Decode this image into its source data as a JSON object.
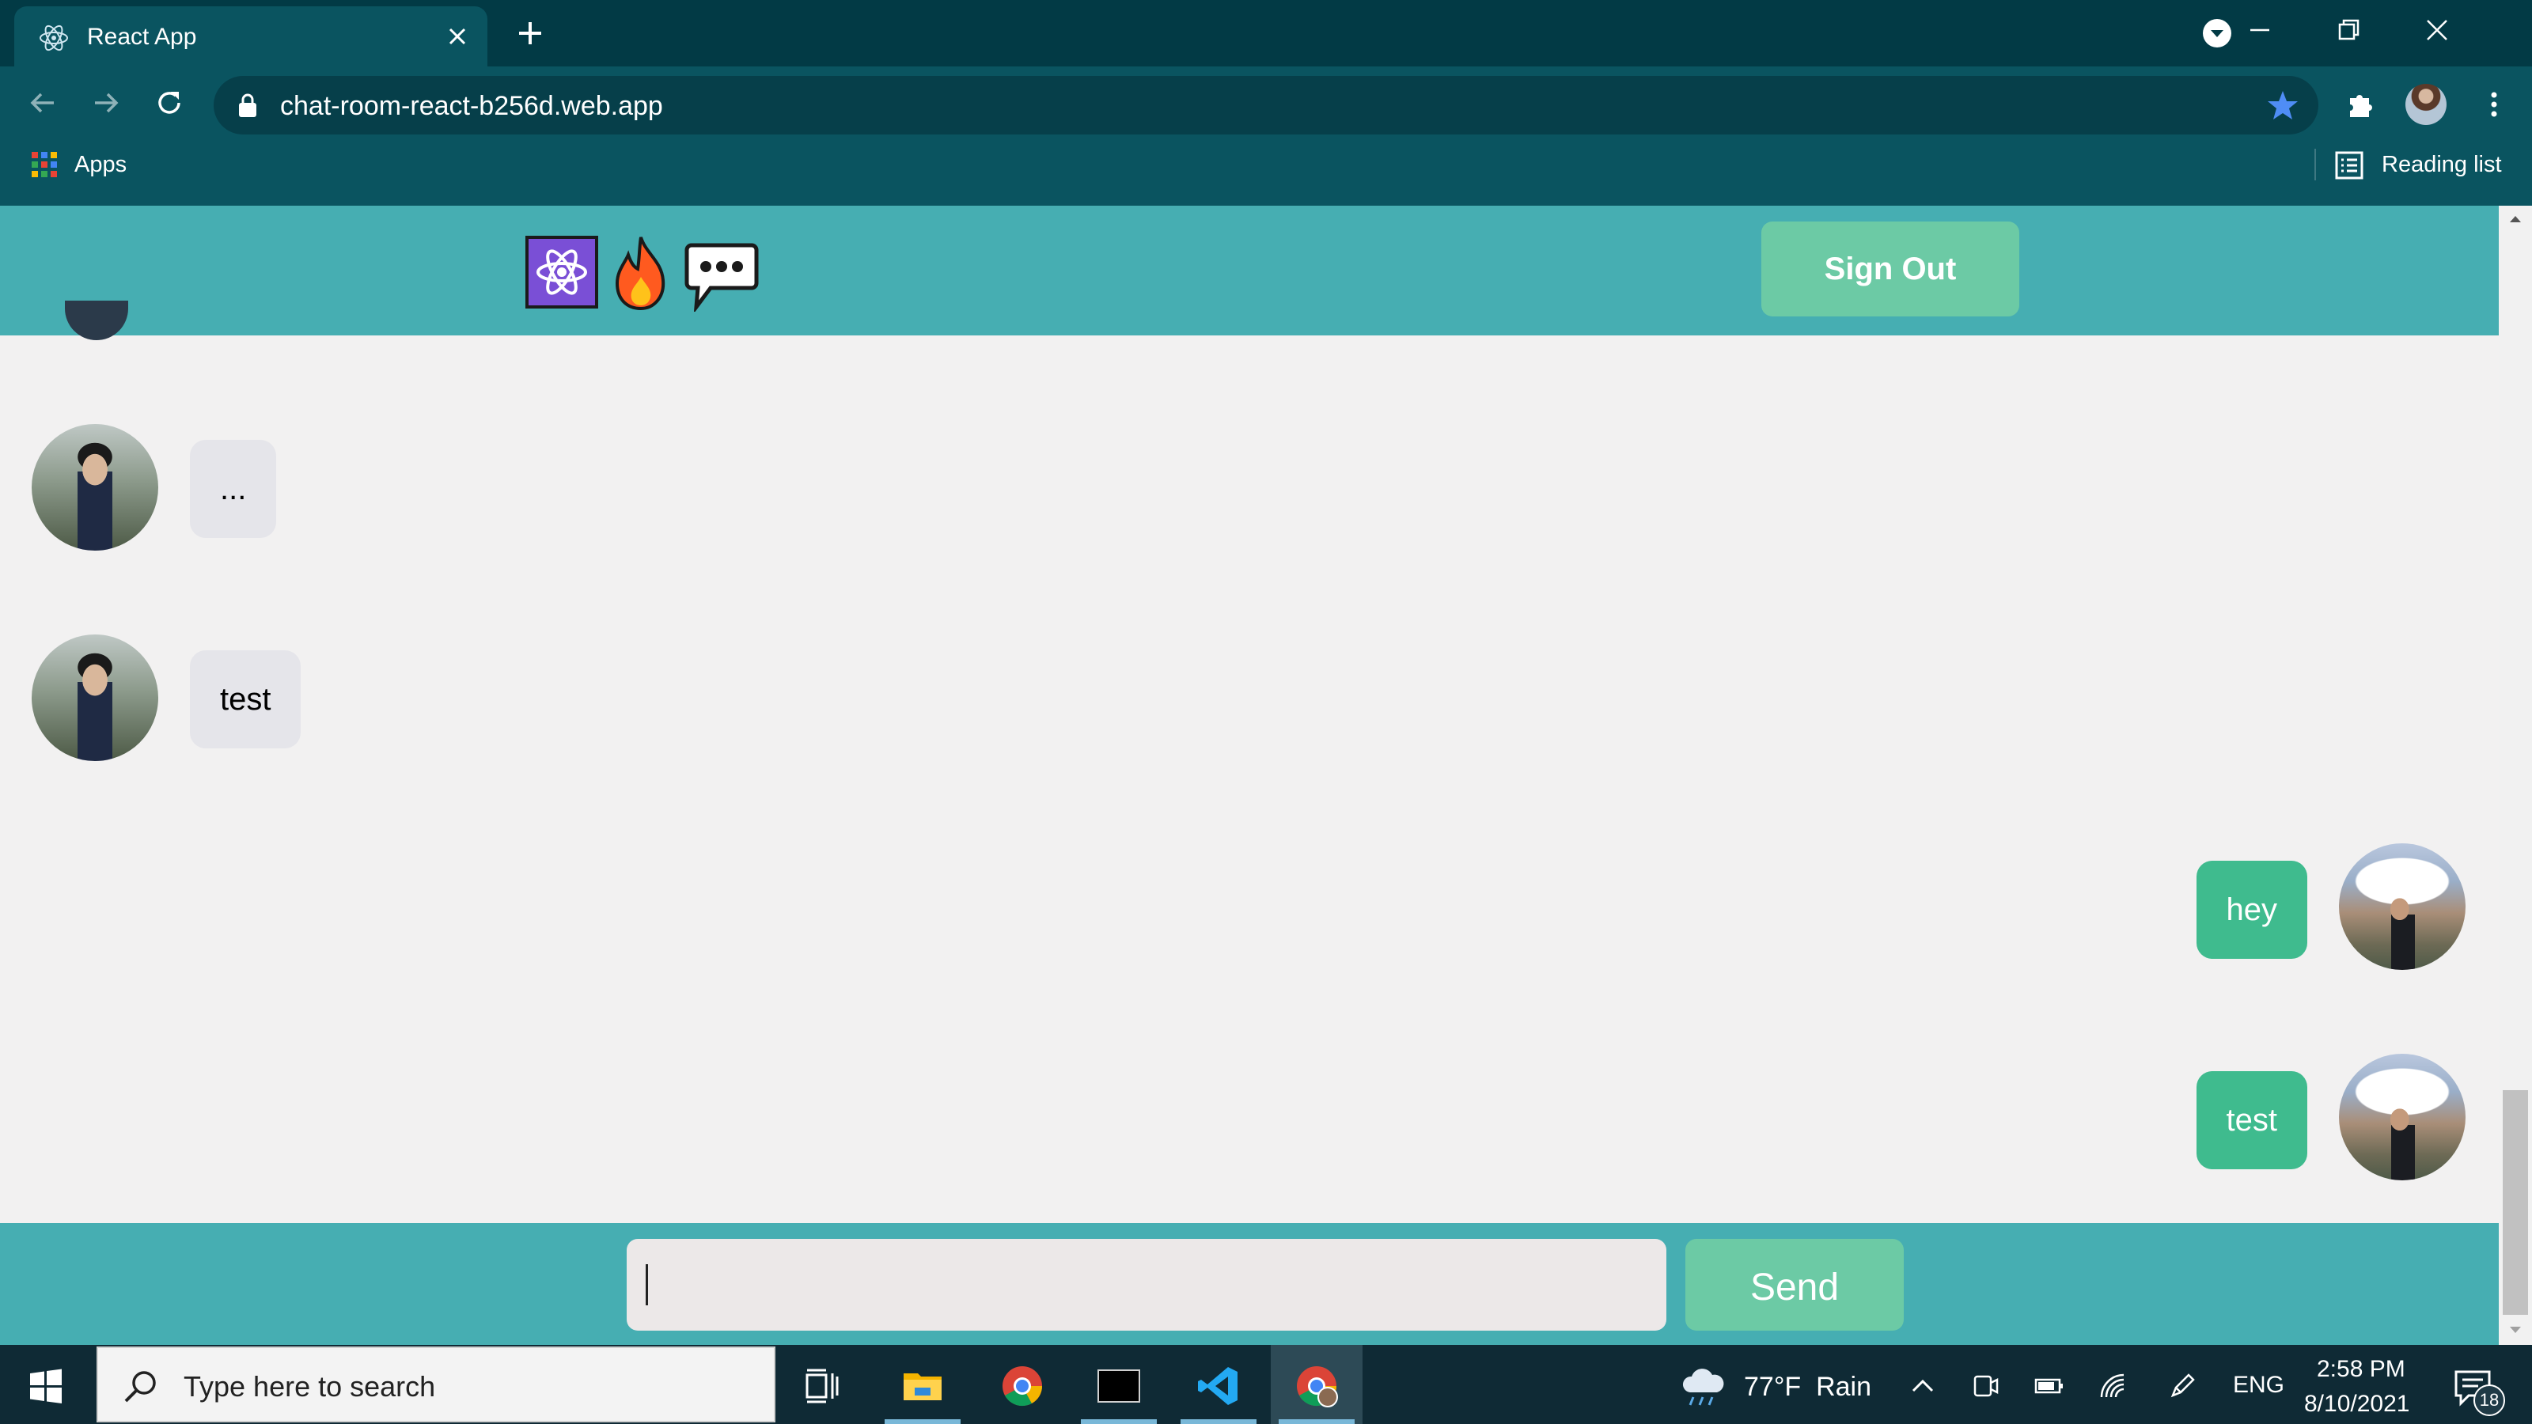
{
  "browser": {
    "tab_title": "React App",
    "url": "chat-room-react-b256d.web.app",
    "bookmarks": {
      "apps_label": "Apps",
      "reading_list_label": "Reading list"
    },
    "icons": [
      "react-favicon",
      "close-icon",
      "plus-icon",
      "tab-search-icon",
      "minimize-icon",
      "restore-icon",
      "window-close-icon",
      "back-arrow-icon",
      "forward-arrow-icon",
      "reload-icon",
      "lock-icon",
      "star-icon",
      "puzzle-icon",
      "kebab-menu-icon",
      "apps-grid-icon",
      "reading-list-icon"
    ],
    "accent_color": "#0a5460"
  },
  "app": {
    "header": {
      "logos": [
        "react-logo-icon",
        "fire-icon",
        "chat-bubble-icon"
      ],
      "sign_out_label": "Sign Out",
      "color": "#46aeb2",
      "button_color": "#6ccaa5"
    },
    "messages": [
      {
        "text": "...",
        "direction": "received"
      },
      {
        "text": "test",
        "direction": "received"
      },
      {
        "text": "hey",
        "direction": "sent"
      },
      {
        "text": "test",
        "direction": "sent"
      }
    ],
    "bubble_colors": {
      "received": "#e5e5ea",
      "sent": "#3fbb8e"
    },
    "composer": {
      "input_value": "",
      "send_label": "Send"
    }
  },
  "taskbar": {
    "search_placeholder": "Type here to search",
    "apps": [
      "task-view-icon",
      "file-explorer-icon",
      "chrome-icon",
      "terminal-icon",
      "vscode-icon",
      "chrome-profile-icon"
    ],
    "weather": "77°F  Rain",
    "language": "ENG",
    "time": "2:58 PM",
    "date": "8/10/2021",
    "notification_count": "18"
  }
}
